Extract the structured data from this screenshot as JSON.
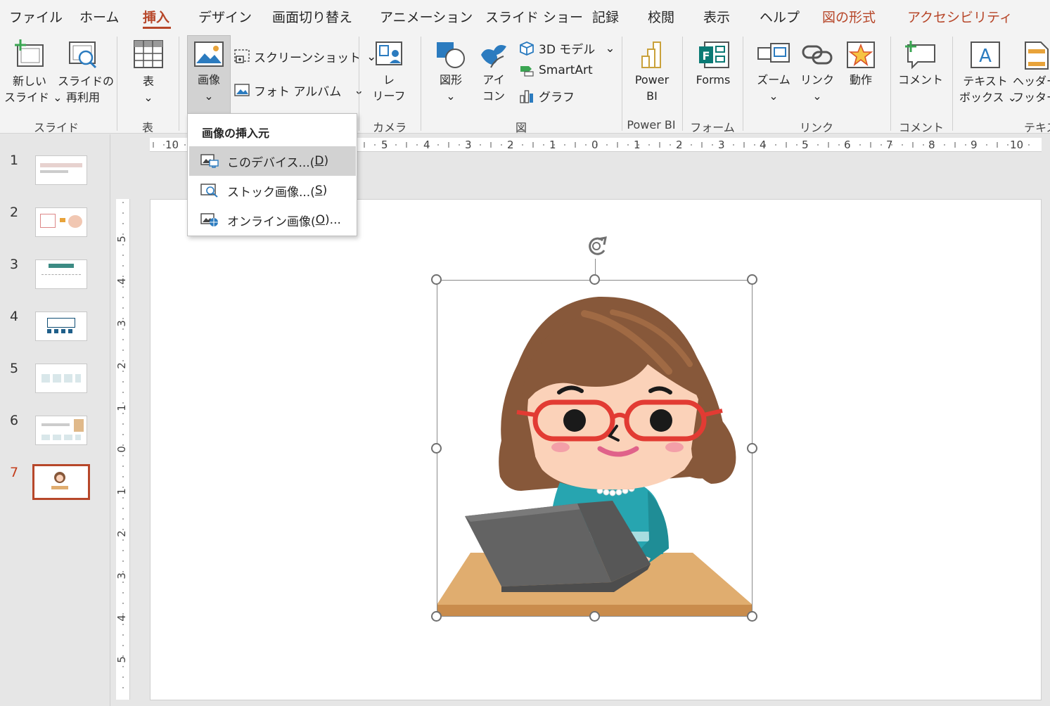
{
  "menu": {
    "tabs": [
      "ファイル",
      "ホーム",
      "挿入",
      "デザイン",
      "画面切り替え",
      "アニメーション",
      "スライド ショー",
      "記録",
      "校閲",
      "表示",
      "ヘルプ",
      "図の形式",
      "アクセシビリティ"
    ],
    "active_tab": "挿入"
  },
  "ribbon": {
    "new_slide": [
      "新しい",
      "スライド"
    ],
    "reuse_slide": [
      "スライドの",
      "再利用"
    ],
    "group_slides": "スライド",
    "table_btn": "表",
    "group_table": "表",
    "image_btn": "画像",
    "screenshot_btn": "スクリーンショット",
    "photo_album_btn": "フォト アルバム",
    "cameo_btn": [
      "レ",
      "リーフ"
    ],
    "group_camera": "カメラ",
    "shapes_btn": "図形",
    "icons_btn": [
      "アイ",
      "コン"
    ],
    "model3d_btn": "3D モデル",
    "smartart_btn": "SmartArt",
    "chart_btn": "グラフ",
    "group_illustrations": "図",
    "powerbi_btn": [
      "Power",
      "BI"
    ],
    "group_powerbi": "Power BI",
    "forms_btn": "Forms",
    "group_forms": "フォーム",
    "zoom_btn": "ズーム",
    "link_btn": "リンク",
    "action_btn": "動作",
    "group_links": "リンク",
    "comment_btn": "コメント",
    "group_comments": "コメント",
    "textbox_btn": [
      "テキスト",
      "ボックス"
    ],
    "header_footer_btn": [
      "ヘッダー",
      "フッター"
    ],
    "group_text": "テキス"
  },
  "dropdown": {
    "title": "画像の挿入元",
    "items": [
      {
        "label": "このデバイス...(",
        "key": "D",
        "suffix": ")"
      },
      {
        "label": "ストック画像...(",
        "key": "S",
        "suffix": ")"
      },
      {
        "label": "オンライン画像(",
        "key": "O",
        "suffix": ")..."
      }
    ]
  },
  "slides": {
    "numbers": [
      "1",
      "2",
      "3",
      "4",
      "5",
      "6",
      "7"
    ],
    "active": "7"
  },
  "ruler": {
    "h": [
      "10",
      "5",
      "4",
      "3",
      "2",
      "1",
      "0",
      "1",
      "2",
      "3",
      "4",
      "5",
      "6",
      "7",
      "8",
      "9",
      "10"
    ],
    "v": [
      "5",
      "4",
      "3",
      "2",
      "1",
      "0",
      "1",
      "2",
      "3",
      "4",
      "5"
    ]
  },
  "colors": {
    "accent": "#b7472a",
    "hair": "#87583a",
    "skin": "#fbd2b9",
    "glasses": "#e23b33",
    "sweater": "#27a5b0",
    "desk": "#e0ad6f",
    "laptop": "#636363"
  }
}
